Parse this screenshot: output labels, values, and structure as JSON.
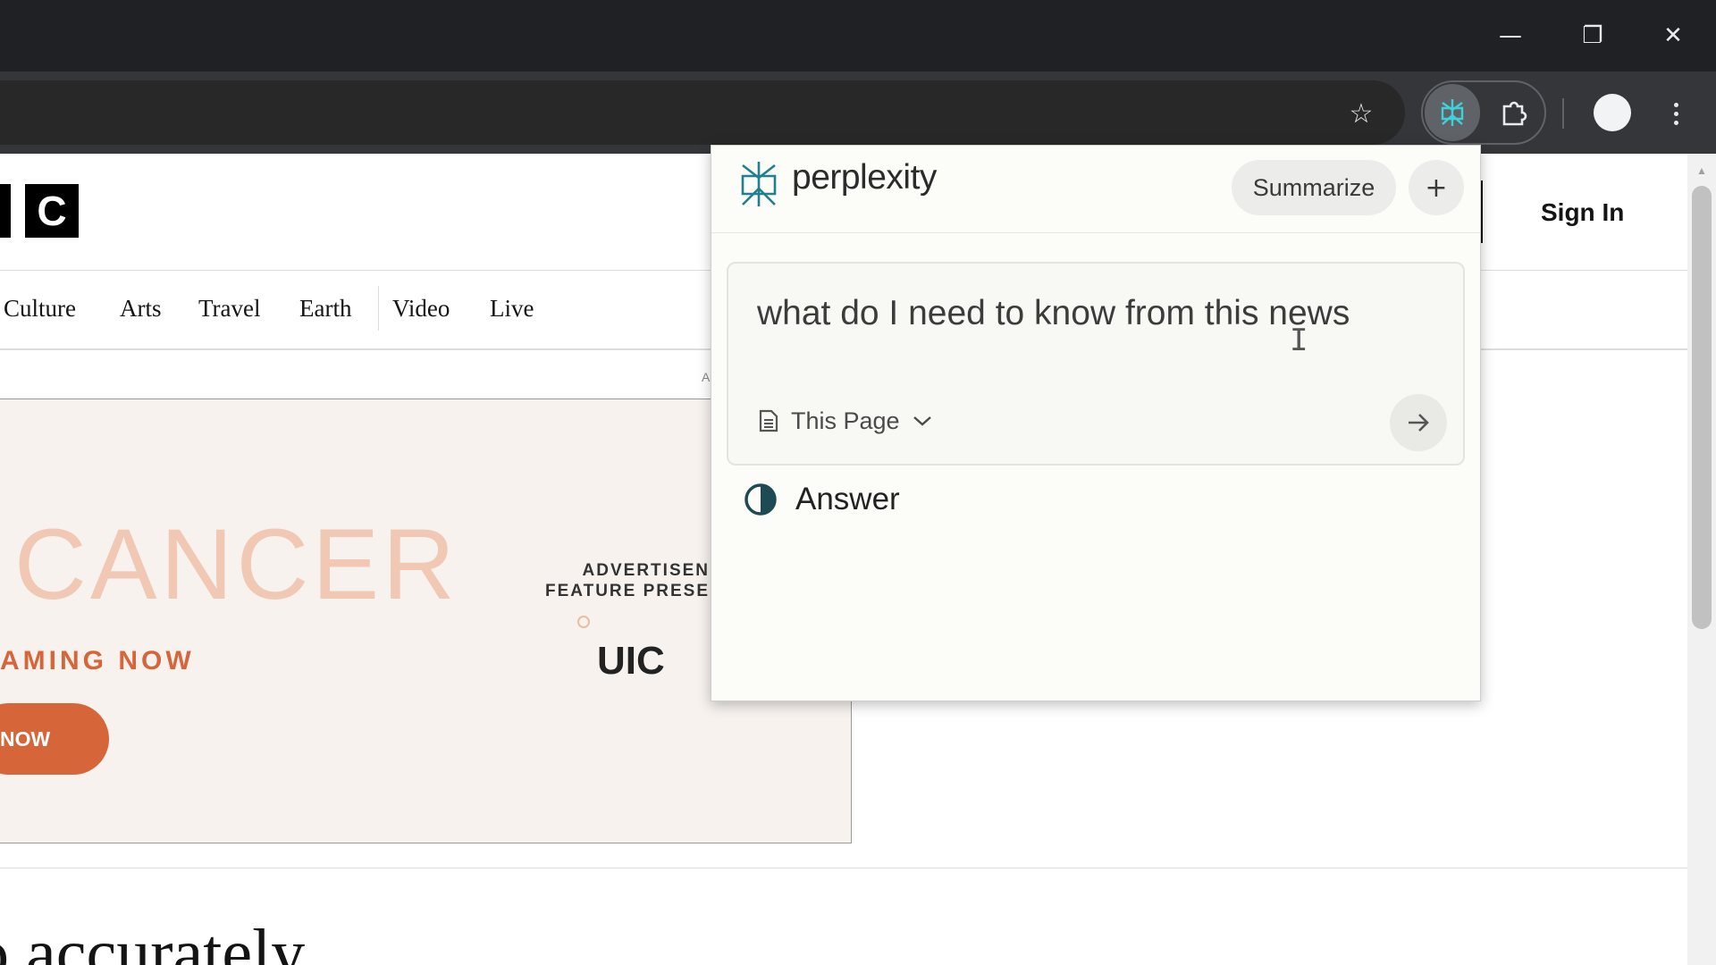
{
  "browser": {
    "window_controls": {
      "minimize": "—",
      "restore": "❐",
      "close": "✕"
    },
    "toolbar_icons": [
      "star-icon",
      "perplexity-icon",
      "puzzle-icon",
      "avatar",
      "kebab-menu-icon"
    ]
  },
  "site": {
    "logo_letter": "C",
    "sign_in": "Sign In",
    "nav": [
      "Culture",
      "Arts",
      "Travel",
      "Earth",
      "Video",
      "Live"
    ],
    "ad": {
      "title": "CANCER",
      "streaming": "AMING NOW",
      "button": "NOW",
      "feature_line1": "ADVERTISEN",
      "feature_line2": "FEATURE PRESE",
      "brand": "UIC",
      "label": "A"
    },
    "headline": "o accurately"
  },
  "popup": {
    "brand": "perplexity",
    "summarize": "Summarize",
    "new_thread": "+",
    "query": "what do I need to know from this news",
    "scope": "This Page",
    "answer_label": "Answer",
    "accent_color": "#20808d"
  }
}
